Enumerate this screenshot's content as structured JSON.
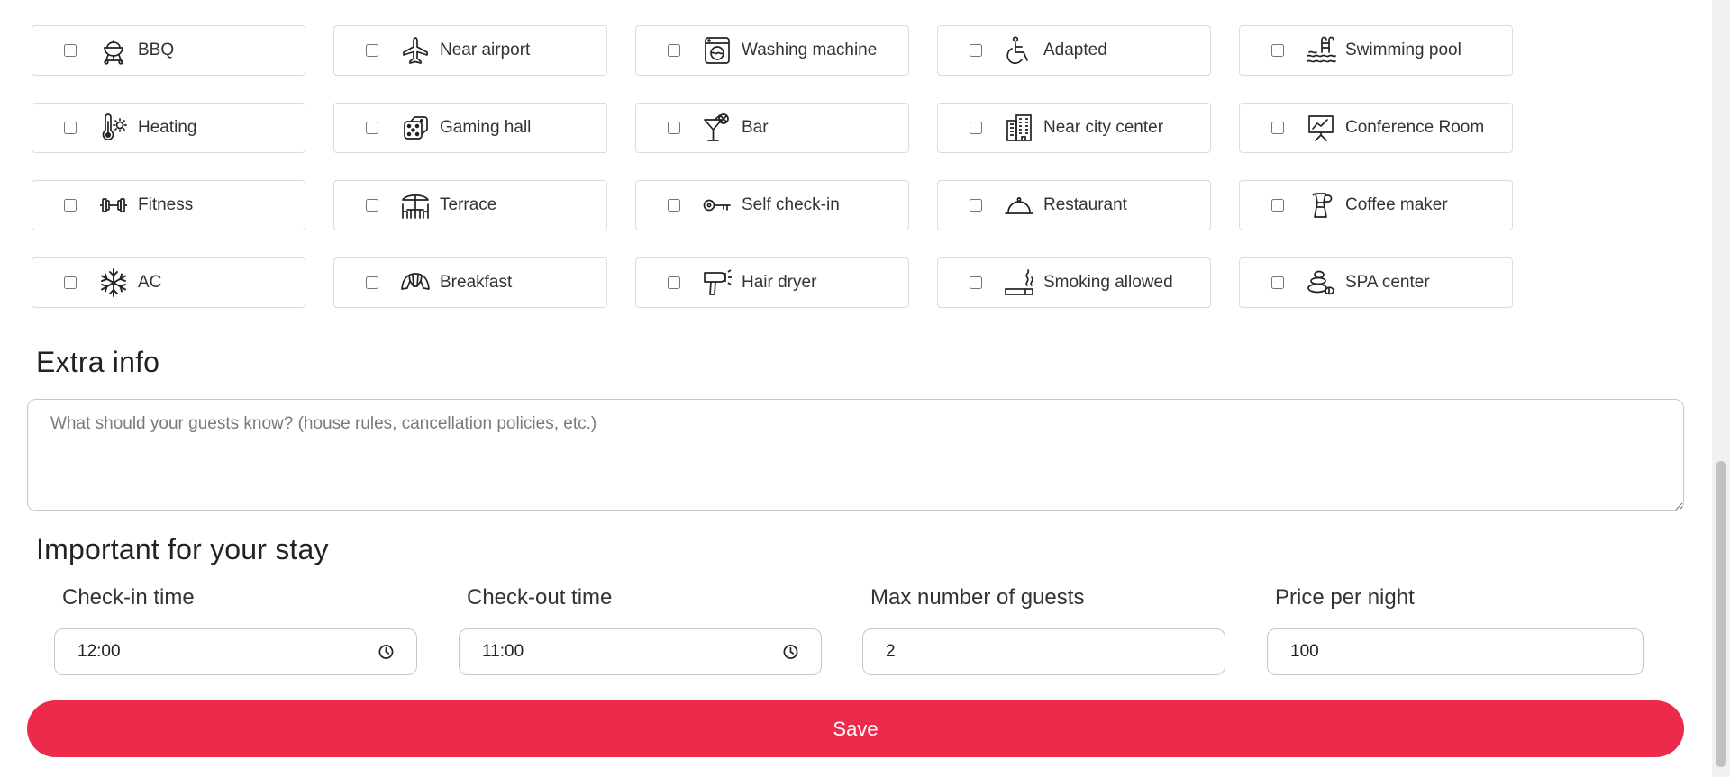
{
  "amenities": [
    {
      "label": "BBQ",
      "icon": "bbq-grill-icon"
    },
    {
      "label": "Near airport",
      "icon": "airplane-icon"
    },
    {
      "label": "Washing machine",
      "icon": "washing-machine-icon"
    },
    {
      "label": "Adapted",
      "icon": "wheelchair-icon"
    },
    {
      "label": "Swimming pool",
      "icon": "swimming-pool-icon"
    },
    {
      "label": "Heating",
      "icon": "thermometer-icon"
    },
    {
      "label": "Gaming hall",
      "icon": "dice-icon"
    },
    {
      "label": "Bar",
      "icon": "cocktail-glass-icon"
    },
    {
      "label": "Near city center",
      "icon": "city-building-icon"
    },
    {
      "label": "Conference Room",
      "icon": "presentation-board-icon"
    },
    {
      "label": "Fitness",
      "icon": "dumbbell-icon"
    },
    {
      "label": "Terrace",
      "icon": "terrace-umbrella-table-icon"
    },
    {
      "label": "Self check-in",
      "icon": "key-icon"
    },
    {
      "label": "Restaurant",
      "icon": "food-cloche-icon"
    },
    {
      "label": "Coffee maker",
      "icon": "moka-pot-icon"
    },
    {
      "label": "AC",
      "icon": "snowflake-icon"
    },
    {
      "label": "Breakfast",
      "icon": "croissant-icon"
    },
    {
      "label": "Hair dryer",
      "icon": "hair-dryer-icon"
    },
    {
      "label": "Smoking allowed",
      "icon": "cigarette-icon"
    },
    {
      "label": "SPA center",
      "icon": "spa-stones-icon"
    }
  ],
  "extra_info": {
    "title": "Extra info",
    "placeholder": "What should your guests know? (house rules, cancellation policies, etc.)",
    "value": ""
  },
  "stay": {
    "title": "Important for your stay",
    "checkin": {
      "label": "Check-in time",
      "value": "12:00"
    },
    "checkout": {
      "label": "Check-out time",
      "value": "11:00"
    },
    "max_guests": {
      "label": "Max number of guests",
      "value": "2"
    },
    "price": {
      "label": "Price per night",
      "value": "100"
    }
  },
  "save_label": "Save",
  "colors": {
    "accent": "#ee2a4c",
    "border": "#dcdcdc"
  }
}
